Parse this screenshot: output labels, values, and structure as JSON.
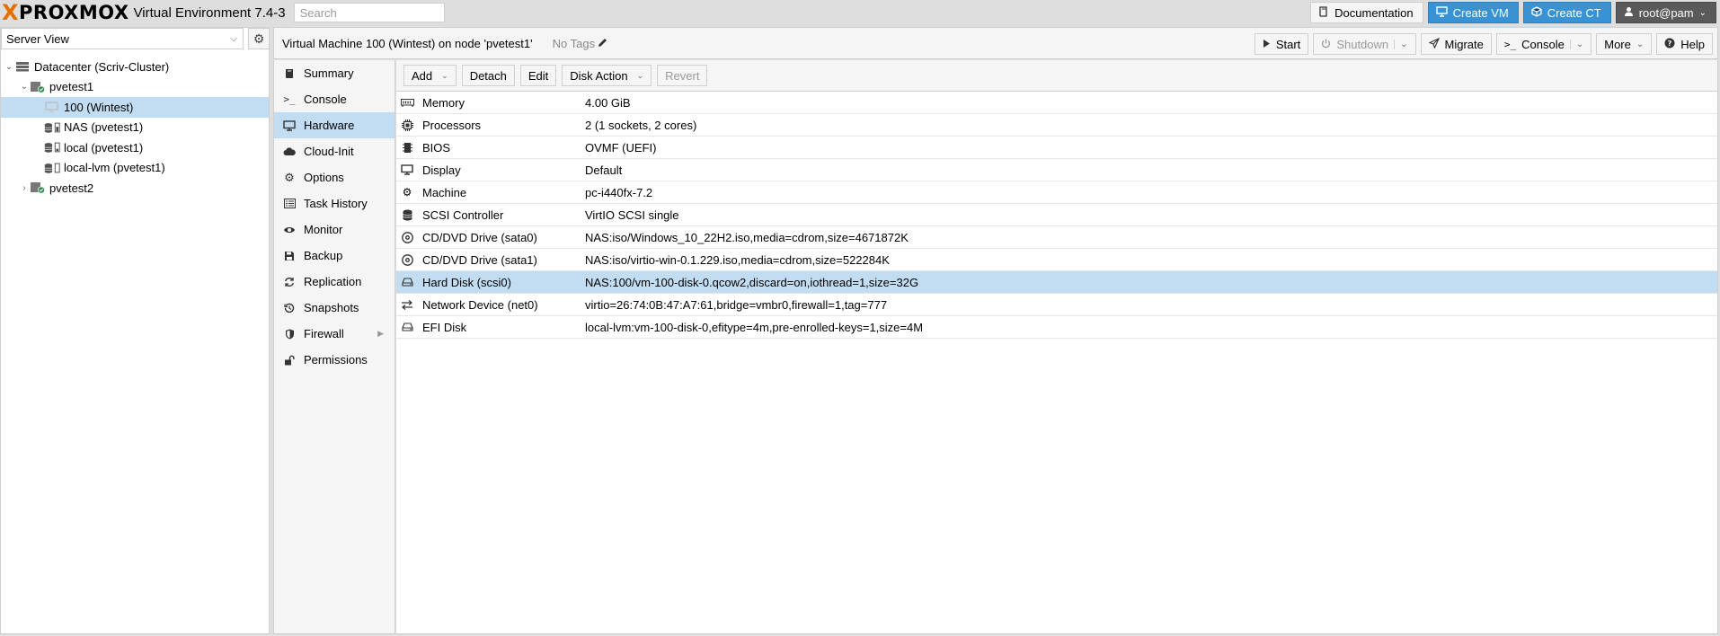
{
  "topbar": {
    "logo_x": "X",
    "logo_text": "PROXMOX",
    "version": "Virtual Environment 7.4-3",
    "search_placeholder": "Search",
    "documentation": "Documentation",
    "create_vm": "Create VM",
    "create_ct": "Create CT",
    "user": "root@pam"
  },
  "tree": {
    "view": "Server View",
    "nodes": [
      {
        "label": "Datacenter (Scriv-Cluster)"
      },
      {
        "label": "pvetest1"
      },
      {
        "label": "100 (Wintest)"
      },
      {
        "label": "NAS (pvetest1)"
      },
      {
        "label": "local (pvetest1)"
      },
      {
        "label": "local-lvm (pvetest1)"
      },
      {
        "label": "pvetest2"
      }
    ]
  },
  "header": {
    "title": "Virtual Machine 100 (Wintest) on node 'pvetest1'",
    "tags": "No Tags",
    "start": "Start",
    "shutdown": "Shutdown",
    "migrate": "Migrate",
    "console": "Console",
    "more": "More",
    "help": "Help"
  },
  "menu": {
    "items": [
      {
        "label": "Summary"
      },
      {
        "label": "Console"
      },
      {
        "label": "Hardware"
      },
      {
        "label": "Cloud-Init"
      },
      {
        "label": "Options"
      },
      {
        "label": "Task History"
      },
      {
        "label": "Monitor"
      },
      {
        "label": "Backup"
      },
      {
        "label": "Replication"
      },
      {
        "label": "Snapshots"
      },
      {
        "label": "Firewall"
      },
      {
        "label": "Permissions"
      }
    ]
  },
  "hardware": {
    "toolbar": {
      "add": "Add",
      "detach": "Detach",
      "edit": "Edit",
      "disk_action": "Disk Action",
      "revert": "Revert"
    },
    "rows": [
      {
        "name": "Memory",
        "value": "4.00 GiB"
      },
      {
        "name": "Processors",
        "value": "2 (1 sockets, 2 cores)"
      },
      {
        "name": "BIOS",
        "value": "OVMF (UEFI)"
      },
      {
        "name": "Display",
        "value": "Default"
      },
      {
        "name": "Machine",
        "value": "pc-i440fx-7.2"
      },
      {
        "name": "SCSI Controller",
        "value": "VirtIO SCSI single"
      },
      {
        "name": "CD/DVD Drive (sata0)",
        "value": "NAS:iso/Windows_10_22H2.iso,media=cdrom,size=4671872K"
      },
      {
        "name": "CD/DVD Drive (sata1)",
        "value": "NAS:iso/virtio-win-0.1.229.iso,media=cdrom,size=522284K"
      },
      {
        "name": "Hard Disk (scsi0)",
        "value": "NAS:100/vm-100-disk-0.qcow2,discard=on,iothread=1,size=32G"
      },
      {
        "name": "Network Device (net0)",
        "value": "virtio=26:74:0B:47:A7:61,bridge=vmbr0,firewall=1,tag=777"
      },
      {
        "name": "EFI Disk",
        "value": "local-lvm:vm-100-disk-0,efitype=4m,pre-enrolled-keys=1,size=4M"
      }
    ]
  },
  "colors": {
    "accent": "#3892d4",
    "selection": "#c2ddf2",
    "logo_orange": "#e57000"
  }
}
